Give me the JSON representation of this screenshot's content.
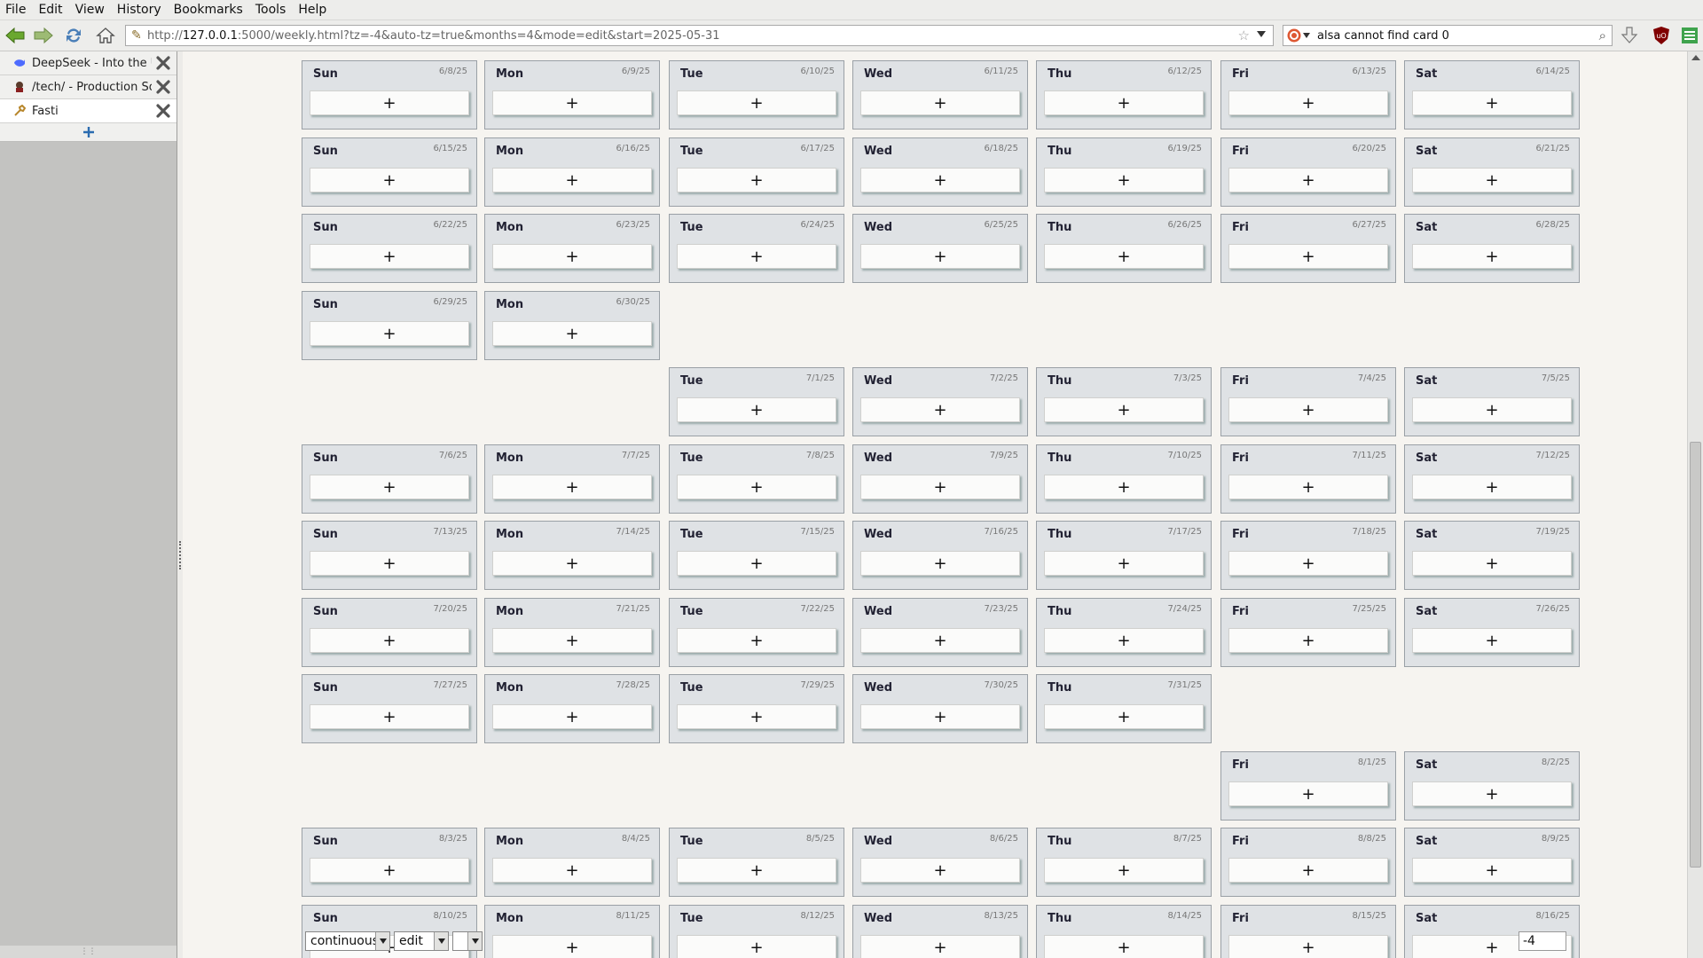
{
  "menu": [
    "File",
    "Edit",
    "View",
    "History",
    "Bookmarks",
    "Tools",
    "Help"
  ],
  "url": {
    "prefix": "http://",
    "host": "127.0.0.1",
    "rest": ":5000/weekly.html?tz=-4&auto-tz=true&months=4&mode=edit&start=2025-05-31"
  },
  "search": {
    "value": "alsa cannot find card 0"
  },
  "tabs": [
    {
      "label": "DeepSeek - Into the Unknown",
      "icon": "deepseek-whale-icon"
    },
    {
      "label": "/tech/ - Production Software",
      "icon": "tech-board-icon"
    },
    {
      "label": "Fasti",
      "icon": "wrench-icon"
    }
  ],
  "colors": {
    "accent": "#2b6cb0",
    "card_bg": "#dfe2e5",
    "card_border": "#9aa0a6",
    "page_bg": "#f6f4f0"
  },
  "calendar": {
    "add_label": "+",
    "rows": [
      [
        [
          "Sun",
          "6/8/25"
        ],
        [
          "Mon",
          "6/9/25"
        ],
        [
          "Tue",
          "6/10/25"
        ],
        [
          "Wed",
          "6/11/25"
        ],
        [
          "Thu",
          "6/12/25"
        ],
        [
          "Fri",
          "6/13/25"
        ],
        [
          "Sat",
          "6/14/25"
        ]
      ],
      [
        [
          "Sun",
          "6/15/25"
        ],
        [
          "Mon",
          "6/16/25"
        ],
        [
          "Tue",
          "6/17/25"
        ],
        [
          "Wed",
          "6/18/25"
        ],
        [
          "Thu",
          "6/19/25"
        ],
        [
          "Fri",
          "6/20/25"
        ],
        [
          "Sat",
          "6/21/25"
        ]
      ],
      [
        [
          "Sun",
          "6/22/25"
        ],
        [
          "Mon",
          "6/23/25"
        ],
        [
          "Tue",
          "6/24/25"
        ],
        [
          "Wed",
          "6/25/25"
        ],
        [
          "Thu",
          "6/26/25"
        ],
        [
          "Fri",
          "6/27/25"
        ],
        [
          "Sat",
          "6/28/25"
        ]
      ],
      [
        [
          "Sun",
          "6/29/25"
        ],
        [
          "Mon",
          "6/30/25"
        ],
        null,
        null,
        null,
        null,
        null
      ],
      [
        null,
        null,
        [
          "Tue",
          "7/1/25"
        ],
        [
          "Wed",
          "7/2/25"
        ],
        [
          "Thu",
          "7/3/25"
        ],
        [
          "Fri",
          "7/4/25"
        ],
        [
          "Sat",
          "7/5/25"
        ]
      ],
      [
        [
          "Sun",
          "7/6/25"
        ],
        [
          "Mon",
          "7/7/25"
        ],
        [
          "Tue",
          "7/8/25"
        ],
        [
          "Wed",
          "7/9/25"
        ],
        [
          "Thu",
          "7/10/25"
        ],
        [
          "Fri",
          "7/11/25"
        ],
        [
          "Sat",
          "7/12/25"
        ]
      ],
      [
        [
          "Sun",
          "7/13/25"
        ],
        [
          "Mon",
          "7/14/25"
        ],
        [
          "Tue",
          "7/15/25"
        ],
        [
          "Wed",
          "7/16/25"
        ],
        [
          "Thu",
          "7/17/25"
        ],
        [
          "Fri",
          "7/18/25"
        ],
        [
          "Sat",
          "7/19/25"
        ]
      ],
      [
        [
          "Sun",
          "7/20/25"
        ],
        [
          "Mon",
          "7/21/25"
        ],
        [
          "Tue",
          "7/22/25"
        ],
        [
          "Wed",
          "7/23/25"
        ],
        [
          "Thu",
          "7/24/25"
        ],
        [
          "Fri",
          "7/25/25"
        ],
        [
          "Sat",
          "7/26/25"
        ]
      ],
      [
        [
          "Sun",
          "7/27/25"
        ],
        [
          "Mon",
          "7/28/25"
        ],
        [
          "Tue",
          "7/29/25"
        ],
        [
          "Wed",
          "7/30/25"
        ],
        [
          "Thu",
          "7/31/25"
        ],
        null,
        null
      ],
      [
        null,
        null,
        null,
        null,
        null,
        [
          "Fri",
          "8/1/25"
        ],
        [
          "Sat",
          "8/2/25"
        ]
      ],
      [
        [
          "Sun",
          "8/3/25"
        ],
        [
          "Mon",
          "8/4/25"
        ],
        [
          "Tue",
          "8/5/25"
        ],
        [
          "Wed",
          "8/6/25"
        ],
        [
          "Thu",
          "8/7/25"
        ],
        [
          "Fri",
          "8/8/25"
        ],
        [
          "Sat",
          "8/9/25"
        ]
      ],
      [
        [
          "Sun",
          "8/10/25"
        ],
        [
          "Mon",
          "8/11/25"
        ],
        [
          "Tue",
          "8/12/25"
        ],
        [
          "Wed",
          "8/13/25"
        ],
        [
          "Thu",
          "8/14/25"
        ],
        [
          "Fri",
          "8/15/25"
        ],
        [
          "Sat",
          "8/16/25"
        ]
      ]
    ]
  },
  "controls": {
    "view_mode": "continuous",
    "edit_mode": "edit",
    "extra_select": "",
    "tz_offset": "-4"
  }
}
